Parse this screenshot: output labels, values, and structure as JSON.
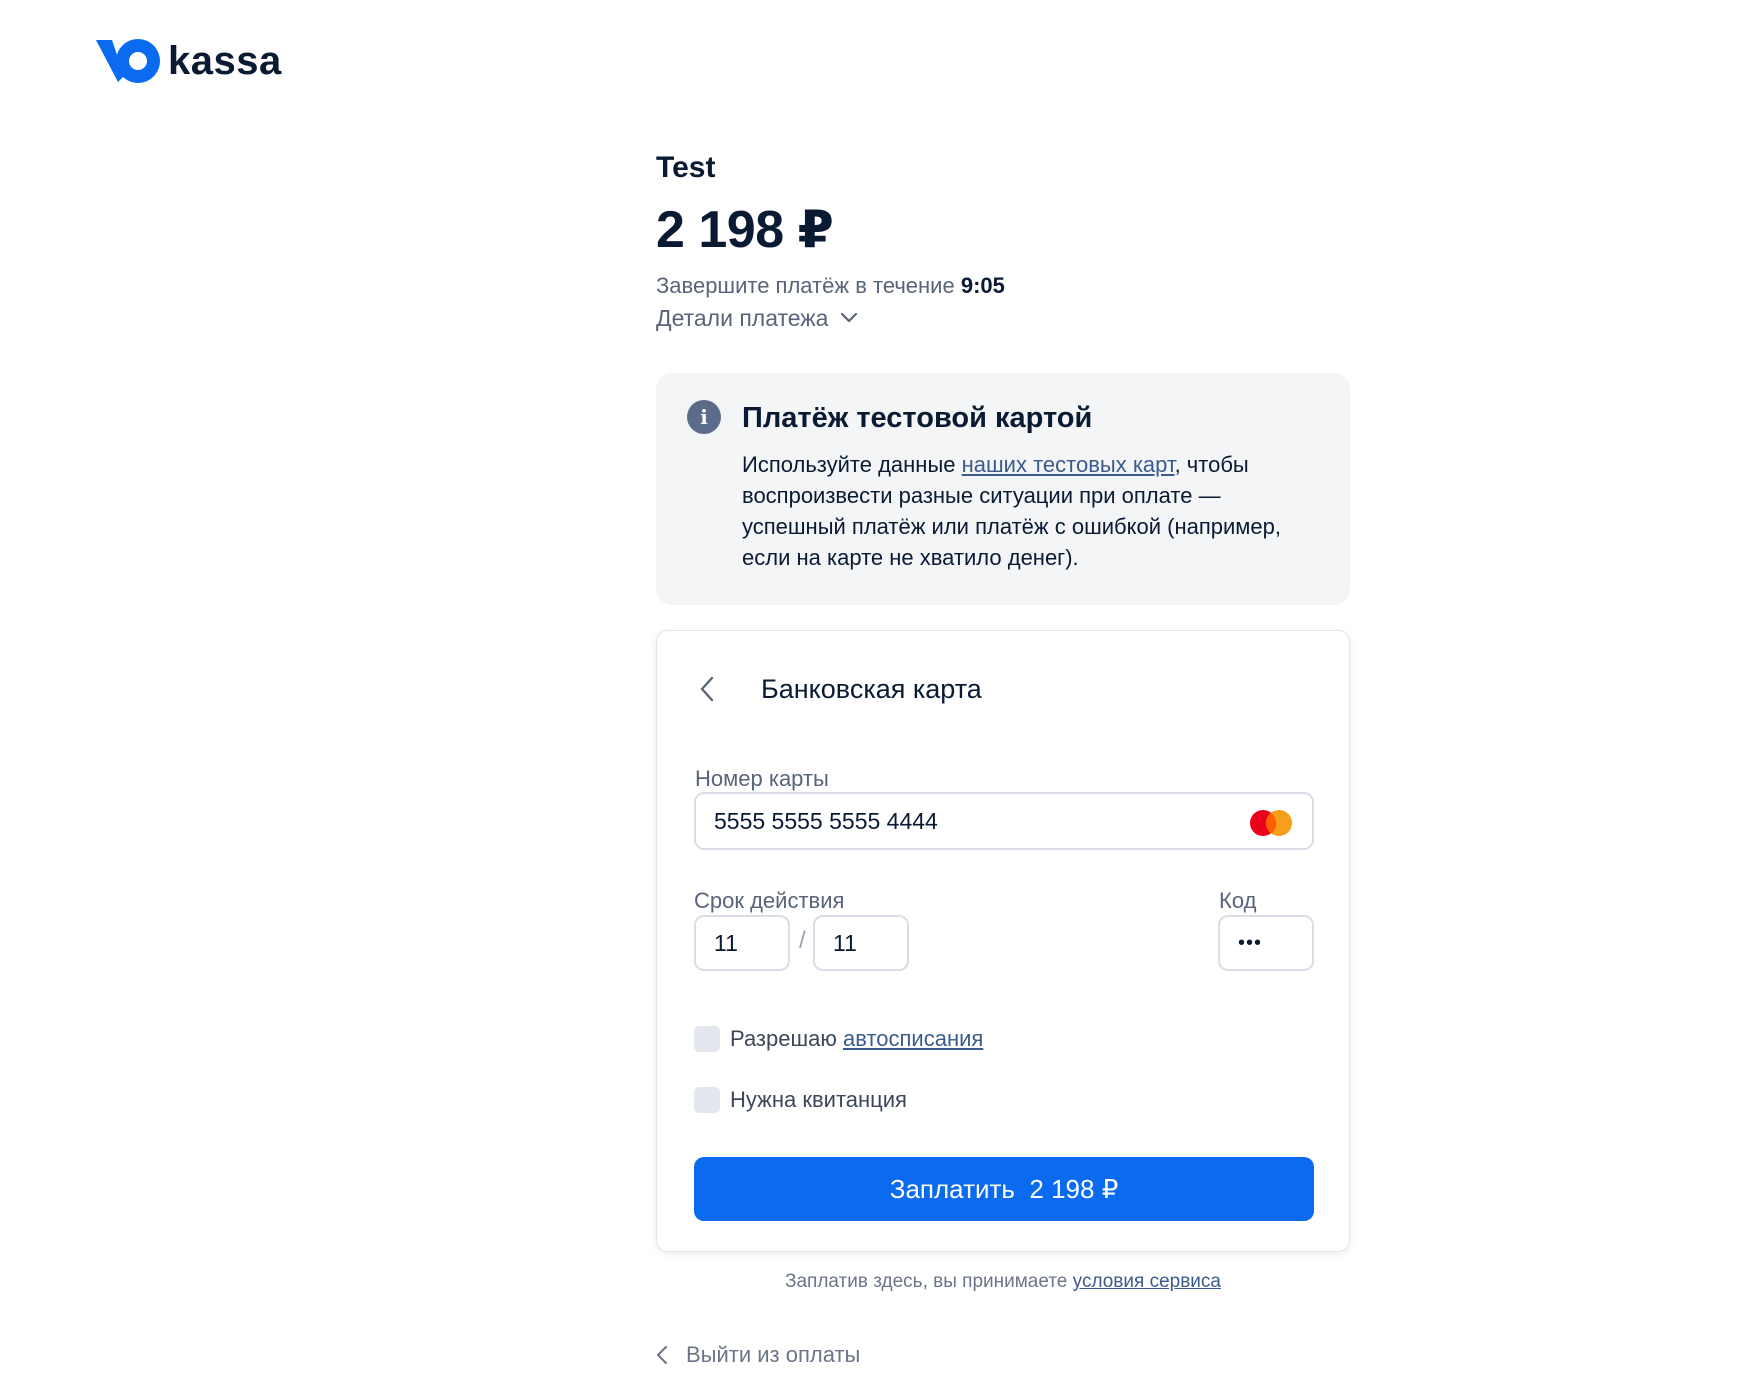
{
  "brand": {
    "logo_text": "kassa",
    "accent": "#0a6bf0"
  },
  "order": {
    "merchant": "Test",
    "amount": "2 198 ₽",
    "timer_prefix": "Завершите платёж в течение",
    "timer_value": "9:05",
    "details_label": "Детали платежа"
  },
  "info": {
    "title": "Платёж тестовой картой",
    "text_before": "Используйте данные",
    "link_text": "наших тестовых карт",
    "text_after": ", чтобы воспроизвести разные ситуации при оплате — успешный платёж или платёж с ошибкой (например, если на карте не хватило денег)."
  },
  "card_form": {
    "title": "Банковская карта",
    "card_number_label": "Номер карты",
    "card_number_value": "5555 5555 5555 4444",
    "card_brand_icon": "mastercard-icon",
    "expiry_label": "Срок действия",
    "expiry_month": "11",
    "expiry_separator": "/",
    "expiry_year": "11",
    "cvc_label": "Код",
    "cvc_value": "•••",
    "autopay_label": "Разрешаю",
    "autopay_link": "автосписания",
    "receipt_label": "Нужна квитанция",
    "pay_button": "Заплатить  2 198 ₽"
  },
  "footer": {
    "terms_text": "Заплатив здесь, вы принимаете",
    "terms_link": "условия сервиса",
    "exit_label": "Выйти из оплаты"
  }
}
